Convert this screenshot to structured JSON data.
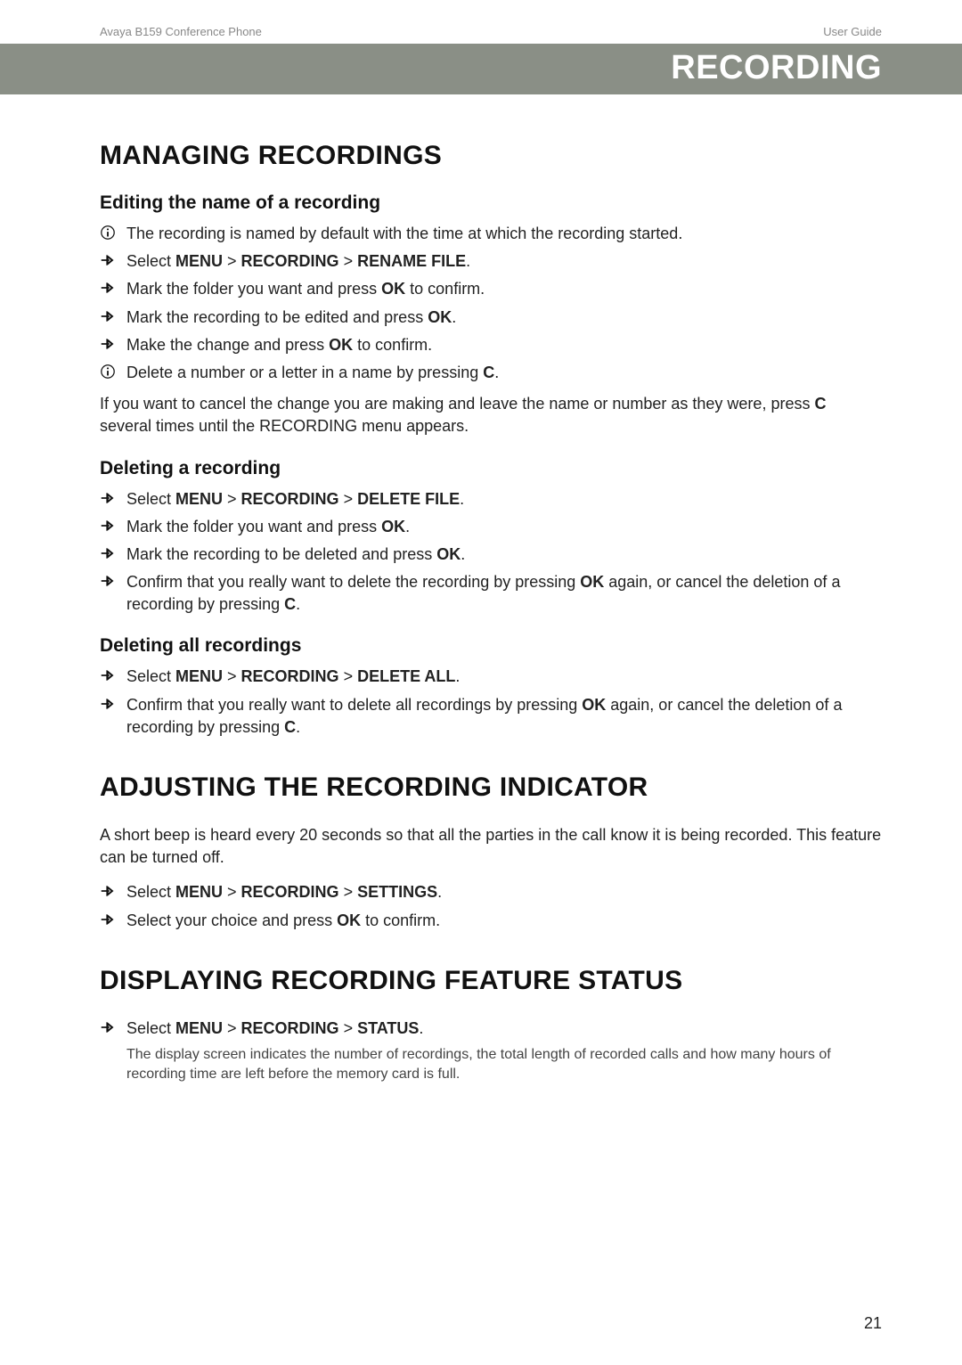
{
  "header": {
    "left": "Avaya B159 Conference Phone",
    "right": "User Guide"
  },
  "title_bar": "RECORDING",
  "sections": {
    "managing": {
      "heading": "MANAGING RECORDINGS",
      "edit": {
        "heading": "Editing the name of a recording",
        "info1": "The recording is named by default with the time at which the recording started.",
        "step1_pre": "Select ",
        "step1_b1": "MENU",
        "step1_gt1": " > ",
        "step1_b2": "RECORDING",
        "step1_gt2": " > ",
        "step1_b3": "RENAME FILE",
        "step1_post": ".",
        "step2_pre": "Mark the folder you want and press ",
        "step2_b": "OK",
        "step2_post": " to confirm.",
        "step3_pre": "Mark the recording to be edited and press ",
        "step3_b": "OK",
        "step3_post": ".",
        "step4_pre": "Make the change and press ",
        "step4_b": "OK",
        "step4_post": " to confirm.",
        "info2_pre": "Delete a number or a letter in a name by pressing ",
        "info2_b": "C",
        "info2_post": ".",
        "para_pre": "If you want to cancel the change you are making and leave the name or number as they were, press ",
        "para_b": "C",
        "para_post": " several times until the RECORDING menu appears."
      },
      "delete": {
        "heading": "Deleting a recording",
        "step1_pre": "Select ",
        "step1_b1": "MENU",
        "step1_gt1": " > ",
        "step1_b2": "RECORDING",
        "step1_gt2": " > ",
        "step1_b3": "DELETE FILE",
        "step1_post": ".",
        "step2_pre": "Mark the folder you want and press ",
        "step2_b": "OK",
        "step2_post": ".",
        "step3_pre": "Mark the recording to be deleted and press ",
        "step3_b": "OK",
        "step3_post": ".",
        "step4_pre": "Confirm that you really want to delete the recording by pressing ",
        "step4_b1": "OK",
        "step4_mid": " again, or cancel the deletion of a recording by pressing ",
        "step4_b2": "C",
        "step4_post": "."
      },
      "delete_all": {
        "heading": "Deleting all recordings",
        "step1_pre": "Select ",
        "step1_b1": "MENU",
        "step1_gt1": " > ",
        "step1_b2": "RECORDING",
        "step1_gt2": " > ",
        "step1_b3": "DELETE ALL",
        "step1_post": ".",
        "step2_pre": "Confirm that you really want to delete all recordings by pressing ",
        "step2_b1": "OK",
        "step2_mid": " again, or cancel the deletion of a recording by pressing ",
        "step2_b2": "C",
        "step2_post": "."
      }
    },
    "adjusting": {
      "heading": "ADJUSTING THE RECORDING INDICATOR",
      "para": "A short beep is heard every 20 seconds so that all the parties in the call know it is being recorded. This feature can be turned off.",
      "step1_pre": "Select ",
      "step1_b1": "MENU",
      "step1_gt1": " > ",
      "step1_b2": "RECORDING",
      "step1_gt2": " > ",
      "step1_b3": "SETTINGS",
      "step1_post": ".",
      "step2_pre": "Select your choice and press ",
      "step2_b": "OK",
      "step2_post": " to confirm."
    },
    "status": {
      "heading": "DISPLAYING RECORDING FEATURE STATUS",
      "step1_pre": "Select ",
      "step1_b1": "MENU",
      "step1_gt1": " > ",
      "step1_b2": "RECORDING",
      "step1_gt2": " > ",
      "step1_b3": "STATUS",
      "step1_post": ".",
      "note": "The display screen indicates the number of recordings, the total length of recorded calls and how many hours of recording time are left before the memory card is full."
    }
  },
  "page_number": "21"
}
